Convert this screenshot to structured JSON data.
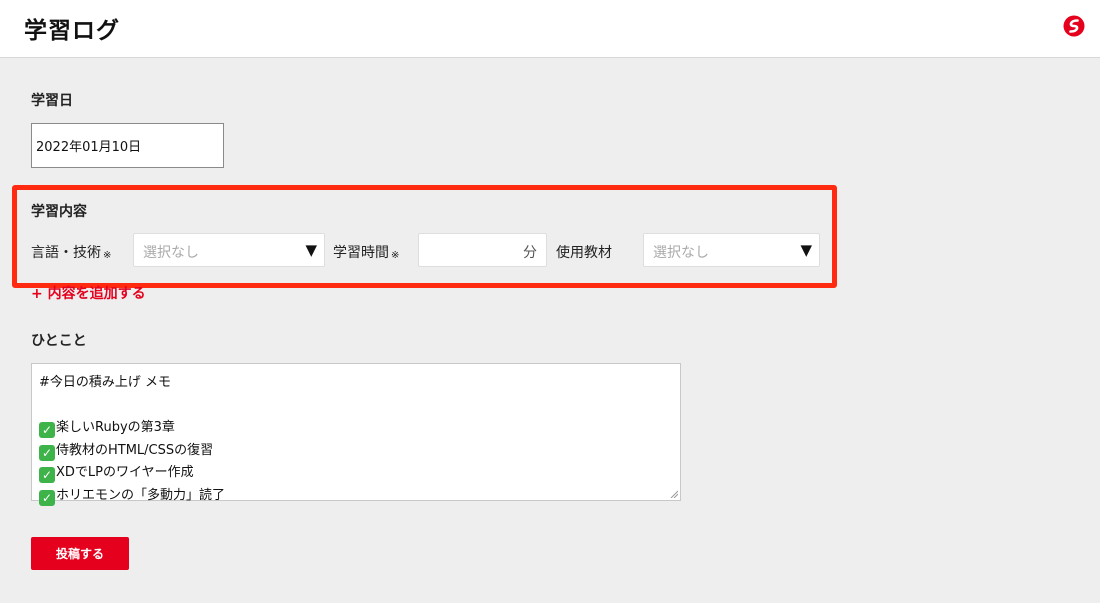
{
  "header": {
    "title": "学習ログ",
    "logo_icon": "brand-logo-icon"
  },
  "form": {
    "study_date": {
      "label": "学習日",
      "value": "2022年01月10日"
    },
    "study_content": {
      "label": "学習内容",
      "language": {
        "label": "言語・技術",
        "required_mark": "※",
        "placeholder": "選択なし"
      },
      "study_time": {
        "label": "学習時間",
        "required_mark": "※",
        "unit": "分"
      },
      "material": {
        "label": "使用教材",
        "placeholder": "選択なし"
      },
      "add_link": "+ 内容を追加する"
    },
    "comment": {
      "label": "ひとこと",
      "lines": [
        {
          "check": false,
          "text": "#今日の積み上げ メモ"
        },
        {
          "check": false,
          "text": ""
        },
        {
          "check": true,
          "text": "楽しいRubyの第3章"
        },
        {
          "check": true,
          "text": "侍教材のHTML/CSSの復習"
        },
        {
          "check": true,
          "text": "XDでLPのワイヤー作成"
        },
        {
          "check": true,
          "text": "ホリエモンの「多動力」読了"
        }
      ]
    },
    "submit_label": "投稿する"
  },
  "colors": {
    "accent": "#e5001d",
    "highlight_border": "#ff2a0f",
    "background": "#eeeeee"
  }
}
